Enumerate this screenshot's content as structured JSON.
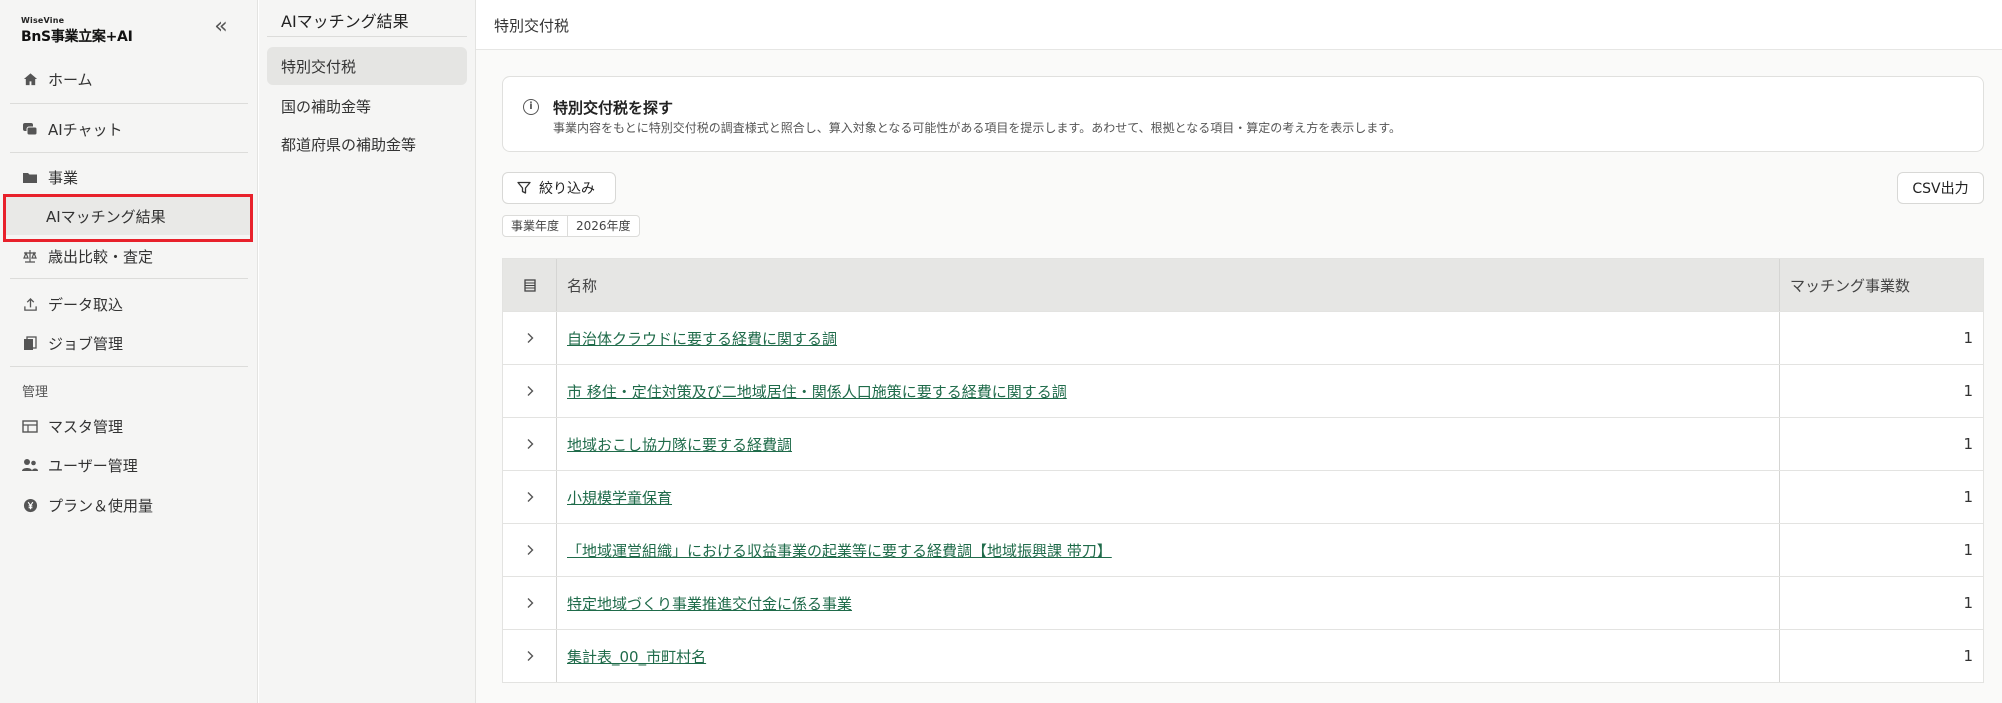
{
  "logo": {
    "small": "WiseVine",
    "big": "BnS事業立案+AI"
  },
  "nav": {
    "collapse_glyph": "«",
    "items": [
      {
        "label": "ホーム",
        "icon": "home-icon"
      },
      {
        "label": "AIチャット",
        "icon": "chat-icon"
      },
      {
        "label": "事業",
        "icon": "folder-icon"
      },
      {
        "label": "AIマッチング結果"
      },
      {
        "label": "歳出比較・査定",
        "icon": "scale-icon"
      },
      {
        "label": "データ取込",
        "icon": "upload-icon"
      },
      {
        "label": "ジョブ管理",
        "icon": "job-icon"
      },
      {
        "label": "マスタ管理",
        "icon": "table-icon"
      },
      {
        "label": "ユーザー管理",
        "icon": "users-icon"
      },
      {
        "label": "プラン＆使用量",
        "icon": "yen-icon"
      }
    ],
    "section_admin": "管理"
  },
  "subnav": {
    "title": "AIマッチング結果",
    "items": [
      "特別交付税",
      "国の補助金等",
      "都道府県の補助金等"
    ]
  },
  "header": {
    "title": "特別交付税"
  },
  "info": {
    "icon": "info-icon",
    "title": "特別交付税を探す",
    "description": "事業内容をもとに特別交付税の調査様式と照合し、算入対象となる可能性がある項目を提示します。あわせて、根拠となる項目・算定の考え方を表示します。"
  },
  "toolbar": {
    "filter_label": "絞り込み",
    "csv_label": "CSV出力"
  },
  "chips": {
    "label": "事業年度",
    "value": "2026年度"
  },
  "table": {
    "headers": {
      "name": "名称",
      "count": "マッチング事業数"
    },
    "rows": [
      {
        "name": "自治体クラウドに要する経費に関する調",
        "count": "1"
      },
      {
        "name": "市 移住・定住対策及び二地域居住・関係人口施策に要する経費に関する調",
        "count": "1"
      },
      {
        "name": "地域おこし協力隊に要する経費調",
        "count": "1"
      },
      {
        "name": "小規模学童保育",
        "count": "1"
      },
      {
        "name": "「地域運営組織」における収益事業の起業等に要する経費調【地域振興課  带刀】",
        "count": "1"
      },
      {
        "name": "特定地域づくり事業推進交付金に係る事業",
        "count": "1"
      },
      {
        "name": "集計表_00_市町村名",
        "count": "1"
      }
    ]
  }
}
